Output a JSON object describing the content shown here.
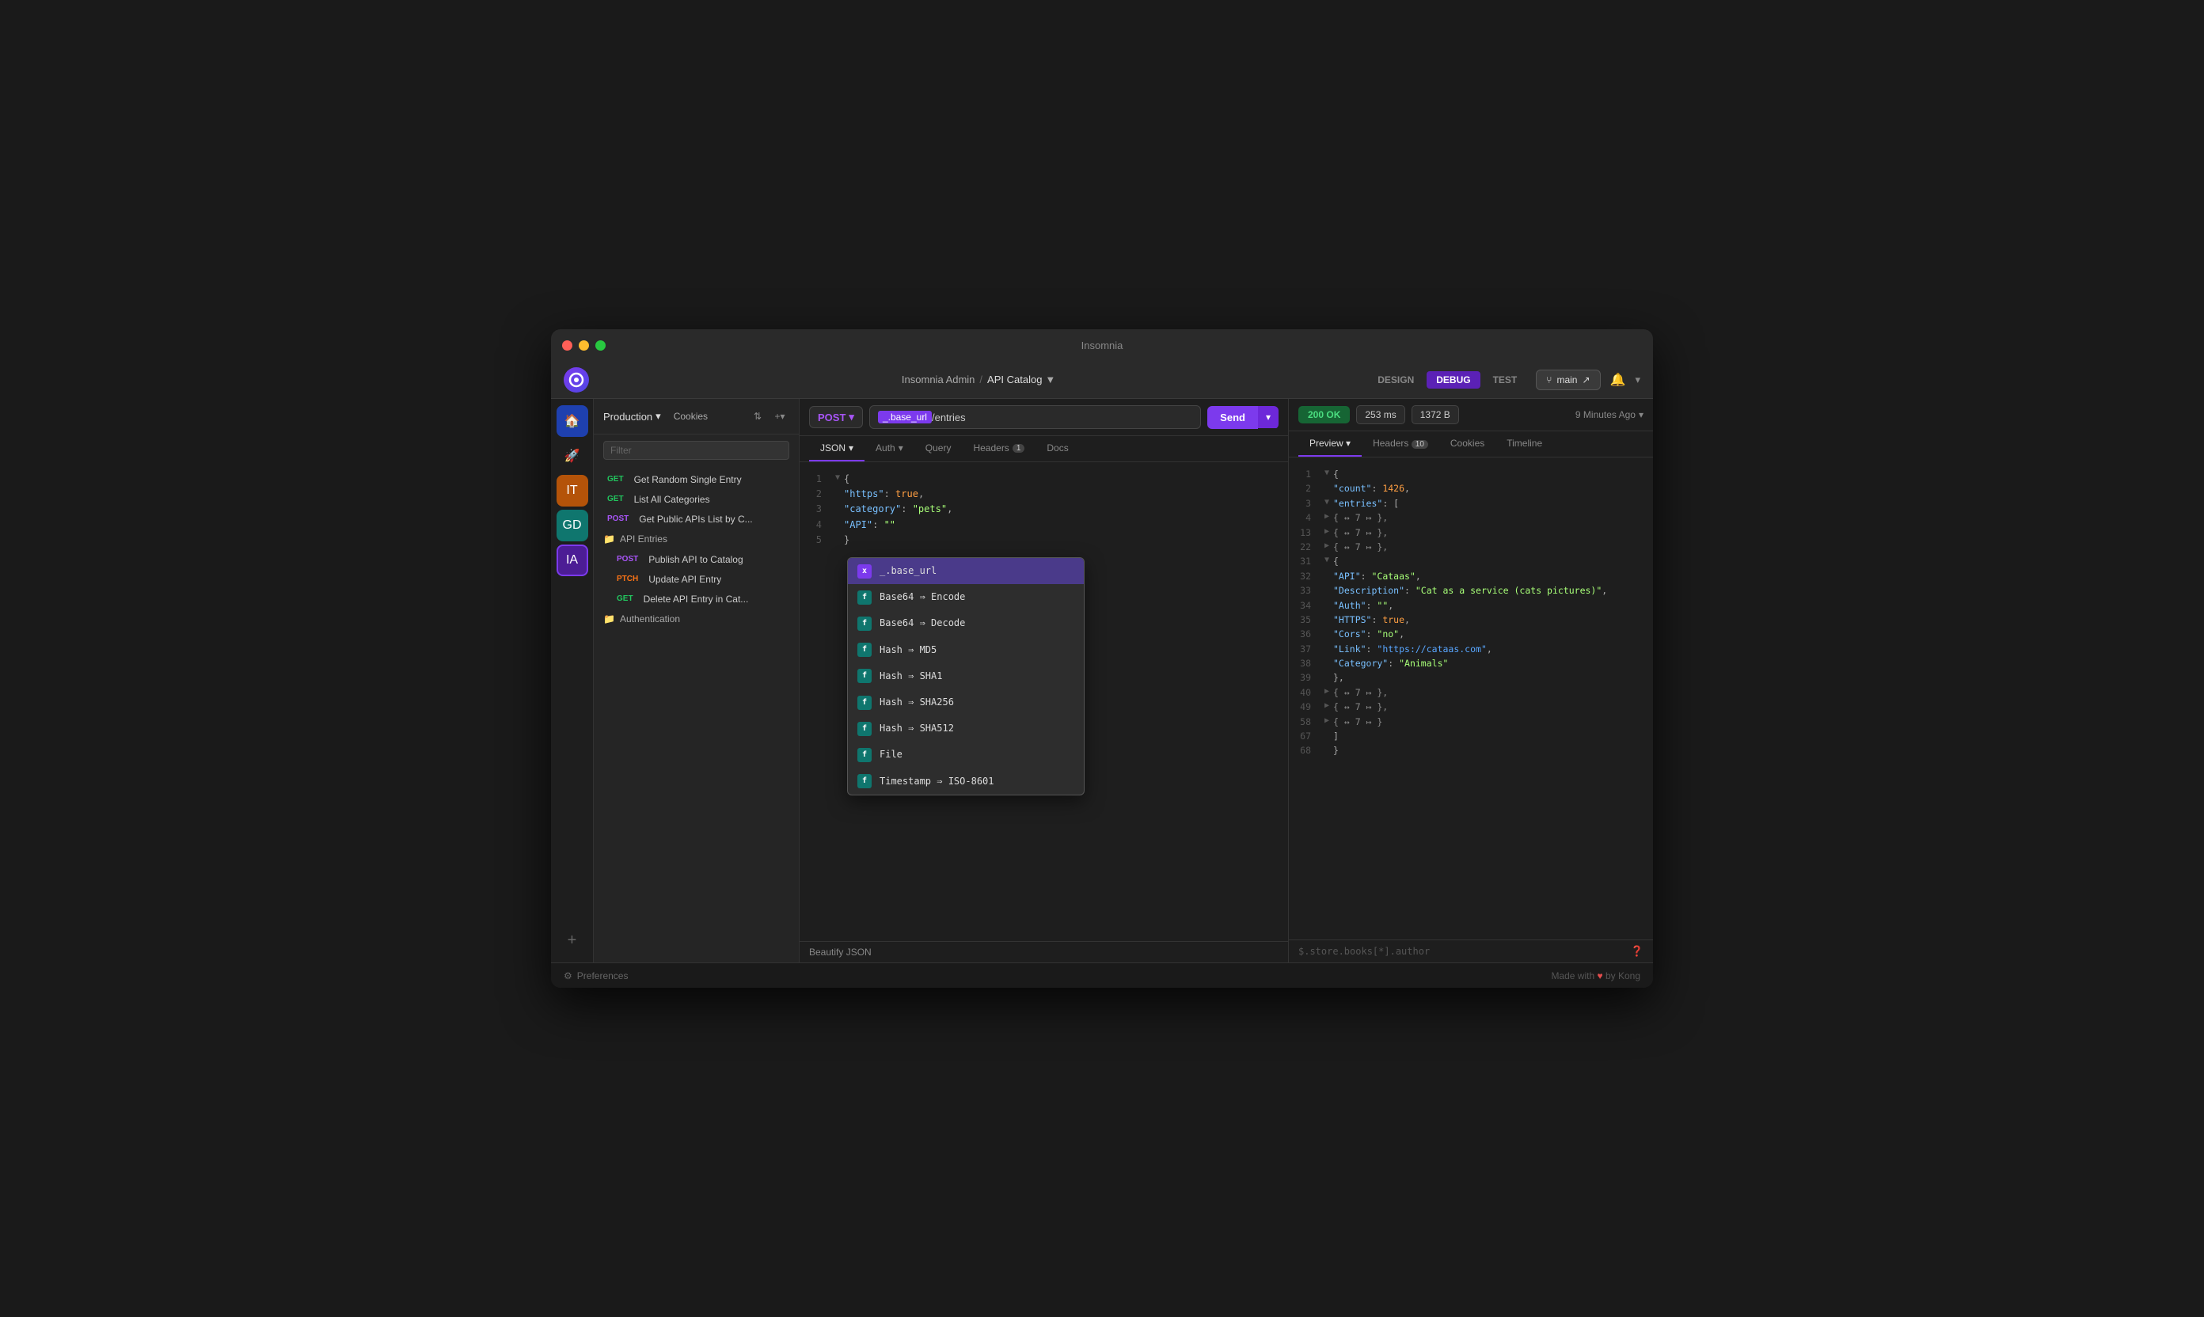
{
  "titlebar": {
    "title": "Insomnia"
  },
  "topnav": {
    "breadcrumb_org": "Insomnia Admin",
    "breadcrumb_sep": "/",
    "breadcrumb_project": "API Catalog",
    "tab_design": "DESIGN",
    "tab_debug": "DEBUG",
    "tab_test": "TEST",
    "branch": "main"
  },
  "sidebar": {
    "icons": [
      {
        "id": "home",
        "label": "🏠",
        "color": "colored-blue"
      },
      {
        "id": "rocket",
        "label": "🚀",
        "color": ""
      },
      {
        "id": "it",
        "label": "IT",
        "color": "colored-orange"
      },
      {
        "id": "gd",
        "label": "GD",
        "color": "colored-teal"
      },
      {
        "id": "ia",
        "label": "IA",
        "color": "colored-purple"
      }
    ],
    "plus_label": "+"
  },
  "left_panel": {
    "env": "Production",
    "cookies": "Cookies",
    "filter_placeholder": "Filter",
    "items": [
      {
        "method": "GET",
        "method_type": "get",
        "label": "Get Random Single Entry"
      },
      {
        "method": "GET",
        "method_type": "get",
        "label": "List All Categories"
      },
      {
        "method": "POST",
        "method_type": "post",
        "label": "Get Public APIs List by C..."
      }
    ],
    "folder_api_entries": "API Entries",
    "folder_api_entries_items": [
      {
        "method": "POST",
        "method_type": "post",
        "label": "Publish API to Catalog"
      },
      {
        "method": "PTCH",
        "method_type": "ptch",
        "label": "Update API Entry"
      },
      {
        "method": "GET",
        "method_type": "delete",
        "label": "Delete API Entry in Cat..."
      }
    ],
    "folder_auth": "Authentication"
  },
  "request_panel": {
    "method": "POST",
    "url_tag": "_.base_url",
    "url_rest": "/entries",
    "send_label": "Send",
    "tabs": [
      {
        "id": "json",
        "label": "JSON",
        "active": true
      },
      {
        "id": "auth",
        "label": "Auth"
      },
      {
        "id": "query",
        "label": "Query"
      },
      {
        "id": "headers",
        "label": "Headers",
        "badge": "1"
      },
      {
        "id": "docs",
        "label": "Docs"
      }
    ],
    "code_lines": [
      {
        "num": "1",
        "gutter": "▼",
        "content": "{"
      },
      {
        "num": "2",
        "gutter": "",
        "content": "  \"https\": true,"
      },
      {
        "num": "3",
        "gutter": "",
        "content": "  \"category\": \"pets\","
      },
      {
        "num": "4",
        "gutter": "",
        "content": "  \"API\": \"\""
      },
      {
        "num": "5",
        "gutter": "",
        "content": "}"
      }
    ],
    "beautify": "Beautify JSON"
  },
  "autocomplete": {
    "items": [
      {
        "badge": "x",
        "badge_type": "x",
        "label": "_.base_url",
        "selected": true
      },
      {
        "badge": "f",
        "badge_type": "f",
        "label": "Base64 ⇒ Encode"
      },
      {
        "badge": "f",
        "badge_type": "f",
        "label": "Base64 ⇒ Decode"
      },
      {
        "badge": "f",
        "badge_type": "f",
        "label": "Hash ⇒ MD5"
      },
      {
        "badge": "f",
        "badge_type": "f",
        "label": "Hash ⇒ SHA1"
      },
      {
        "badge": "f",
        "badge_type": "f",
        "label": "Hash ⇒ SHA256"
      },
      {
        "badge": "f",
        "badge_type": "f",
        "label": "Hash ⇒ SHA512"
      },
      {
        "badge": "f",
        "badge_type": "f",
        "label": "File"
      },
      {
        "badge": "f",
        "badge_type": "f",
        "label": "Timestamp ⇒ ISO-8601"
      }
    ]
  },
  "response_panel": {
    "status": "200 OK",
    "time": "253 ms",
    "size": "1372 B",
    "timestamp": "9 Minutes Ago",
    "tabs": [
      {
        "id": "preview",
        "label": "Preview",
        "active": true
      },
      {
        "id": "headers",
        "label": "Headers",
        "badge": "10"
      },
      {
        "id": "cookies",
        "label": "Cookies"
      },
      {
        "id": "timeline",
        "label": "Timeline"
      }
    ],
    "jsonpath_hint": "$.store.books[*].author",
    "code": [
      {
        "num": "1",
        "gutter": "▼",
        "content": "{"
      },
      {
        "num": "2",
        "gutter": "",
        "content": "  \"count\": 1426,"
      },
      {
        "num": "3",
        "gutter": "▼",
        "content": "  \"entries\": ["
      },
      {
        "num": "4",
        "gutter": "▶",
        "content": "    { ↔ 7 ↦ },"
      },
      {
        "num": "13",
        "gutter": "▶",
        "content": "    { ↔ 7 ↦ },"
      },
      {
        "num": "22",
        "gutter": "▶",
        "content": "    { ↔ 7 ↦ },"
      },
      {
        "num": "31",
        "gutter": "▼",
        "content": "    {"
      },
      {
        "num": "32",
        "gutter": "",
        "content": "      \"API\": \"Cataas\","
      },
      {
        "num": "33",
        "gutter": "",
        "content": "      \"Description\": \"Cat as a service (cats pictures)\","
      },
      {
        "num": "34",
        "gutter": "",
        "content": "      \"Auth\": \"\","
      },
      {
        "num": "35",
        "gutter": "",
        "content": "      \"HTTPS\": true,"
      },
      {
        "num": "36",
        "gutter": "",
        "content": "      \"Cors\": \"no\","
      },
      {
        "num": "37",
        "gutter": "",
        "content": "      \"Link\": \"https://cataas.com\","
      },
      {
        "num": "38",
        "gutter": "",
        "content": "      \"Category\": \"Animals\""
      },
      {
        "num": "39",
        "gutter": "",
        "content": "    },"
      },
      {
        "num": "40",
        "gutter": "▶",
        "content": "    { ↔ 7 ↦ },"
      },
      {
        "num": "49",
        "gutter": "▶",
        "content": "    { ↔ 7 ↦ },"
      },
      {
        "num": "58",
        "gutter": "▶",
        "content": "    { ↔ 7 ↦ }"
      },
      {
        "num": "67",
        "gutter": "",
        "content": "  ]"
      },
      {
        "num": "68",
        "gutter": "",
        "content": "}"
      }
    ]
  },
  "statusbar": {
    "preferences": "Preferences",
    "made_with": "Made with",
    "by_kong": "by Kong"
  }
}
